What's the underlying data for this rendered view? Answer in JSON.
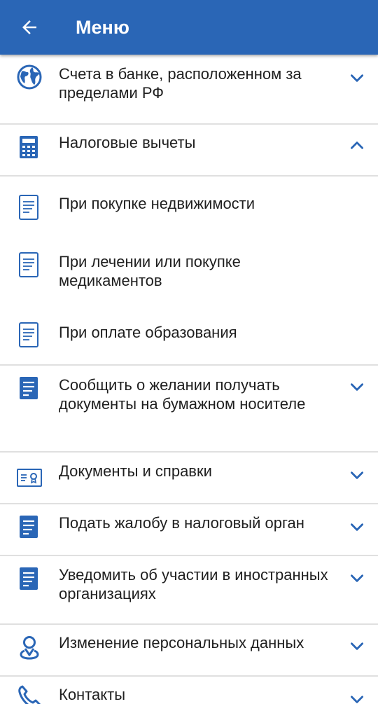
{
  "header": {
    "title": "Меню",
    "back_icon": "arrow-left-icon"
  },
  "colors": {
    "appbar": "#2a66b6",
    "icon": "#2a66b6",
    "divider": "#e0e0e0"
  },
  "menu": {
    "bank_accounts": {
      "label": "Счета в банке, расположенном за пределами РФ",
      "icon": "globe-icon",
      "state": "collapsed"
    },
    "tax_deductions": {
      "label": "Налоговые вычеты",
      "icon": "calculator-icon",
      "state": "expanded",
      "sub": {
        "property": "При покупке недвижимости",
        "treatment": "При лечении или покупке медикаментов",
        "education": "При оплате образования"
      }
    },
    "paper_docs": {
      "label": "Сообщить о желании получать документы на бумажном носителе",
      "icon": "document-icon",
      "state": "collapsed"
    },
    "certificates": {
      "label": "Документы и справки",
      "icon": "certificate-icon",
      "state": "collapsed"
    },
    "complaint": {
      "label": "Подать жалобу в налоговый орган",
      "icon": "document-icon",
      "state": "collapsed"
    },
    "foreign_orgs": {
      "label": "Уведомить об участии в иностранных организациях",
      "icon": "document-icon",
      "state": "collapsed"
    },
    "personal_data": {
      "label": "Изменение персональных данных",
      "icon": "person-pin-icon",
      "state": "collapsed"
    },
    "contacts": {
      "label": "Контакты",
      "icon": "phone-icon",
      "state": "collapsed"
    }
  }
}
